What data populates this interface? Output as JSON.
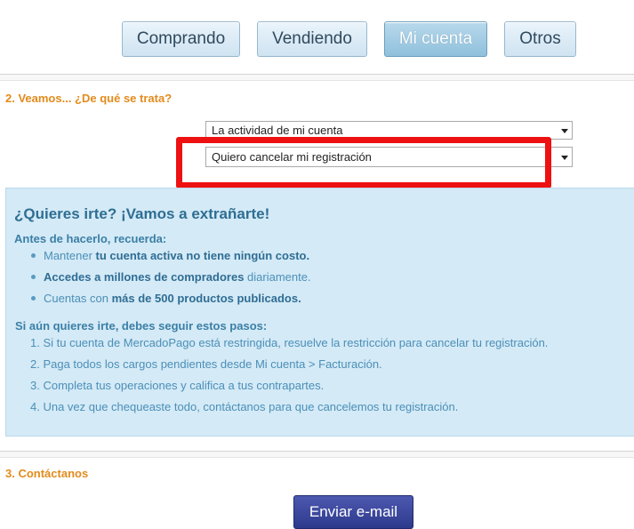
{
  "tabs": [
    {
      "label": "Comprando",
      "active": false
    },
    {
      "label": "Vendiendo",
      "active": false
    },
    {
      "label": "Mi cuenta",
      "active": true
    },
    {
      "label": "Otros",
      "active": false
    }
  ],
  "section2": {
    "title": "2. Veamos... ¿De qué se trata?",
    "select_category": "La actividad de mi cuenta",
    "select_topic": "Quiero cancelar mi registración"
  },
  "info": {
    "heading": "¿Quieres irte? ¡Vamos a extrañarte!",
    "remember_title": "Antes de hacerlo, recuerda:",
    "bullets": [
      {
        "pre": "Mantener ",
        "bold": "tu cuenta activa no tiene ningún costo.",
        "post": ""
      },
      {
        "pre": "",
        "bold": "Accedes a millones de compradores",
        "post": " diariamente."
      },
      {
        "pre": "Cuentas con ",
        "bold": "más de 500 productos publicados.",
        "post": ""
      }
    ],
    "steps_title": "Si aún quieres irte, debes seguir estos pasos:",
    "steps": [
      "1. Si tu cuenta de MercadoPago está restringida, resuelve la restricción para cancelar tu registración.",
      "2. Paga todos los cargos pendientes desde Mi cuenta > Facturación.",
      "3. Completa tus operaciones y califica a tus contrapartes.",
      "4. Una vez que chequeaste todo, contáctanos para que cancelemos tu registración."
    ]
  },
  "section3": {
    "title": "3. Contáctanos",
    "email_button": "Enviar e-mail"
  },
  "colors": {
    "section_title": "#e38b1c",
    "panel_bg": "#d4eaf6",
    "highlight": "#ee1111",
    "email_button": "#2d3a8c"
  }
}
